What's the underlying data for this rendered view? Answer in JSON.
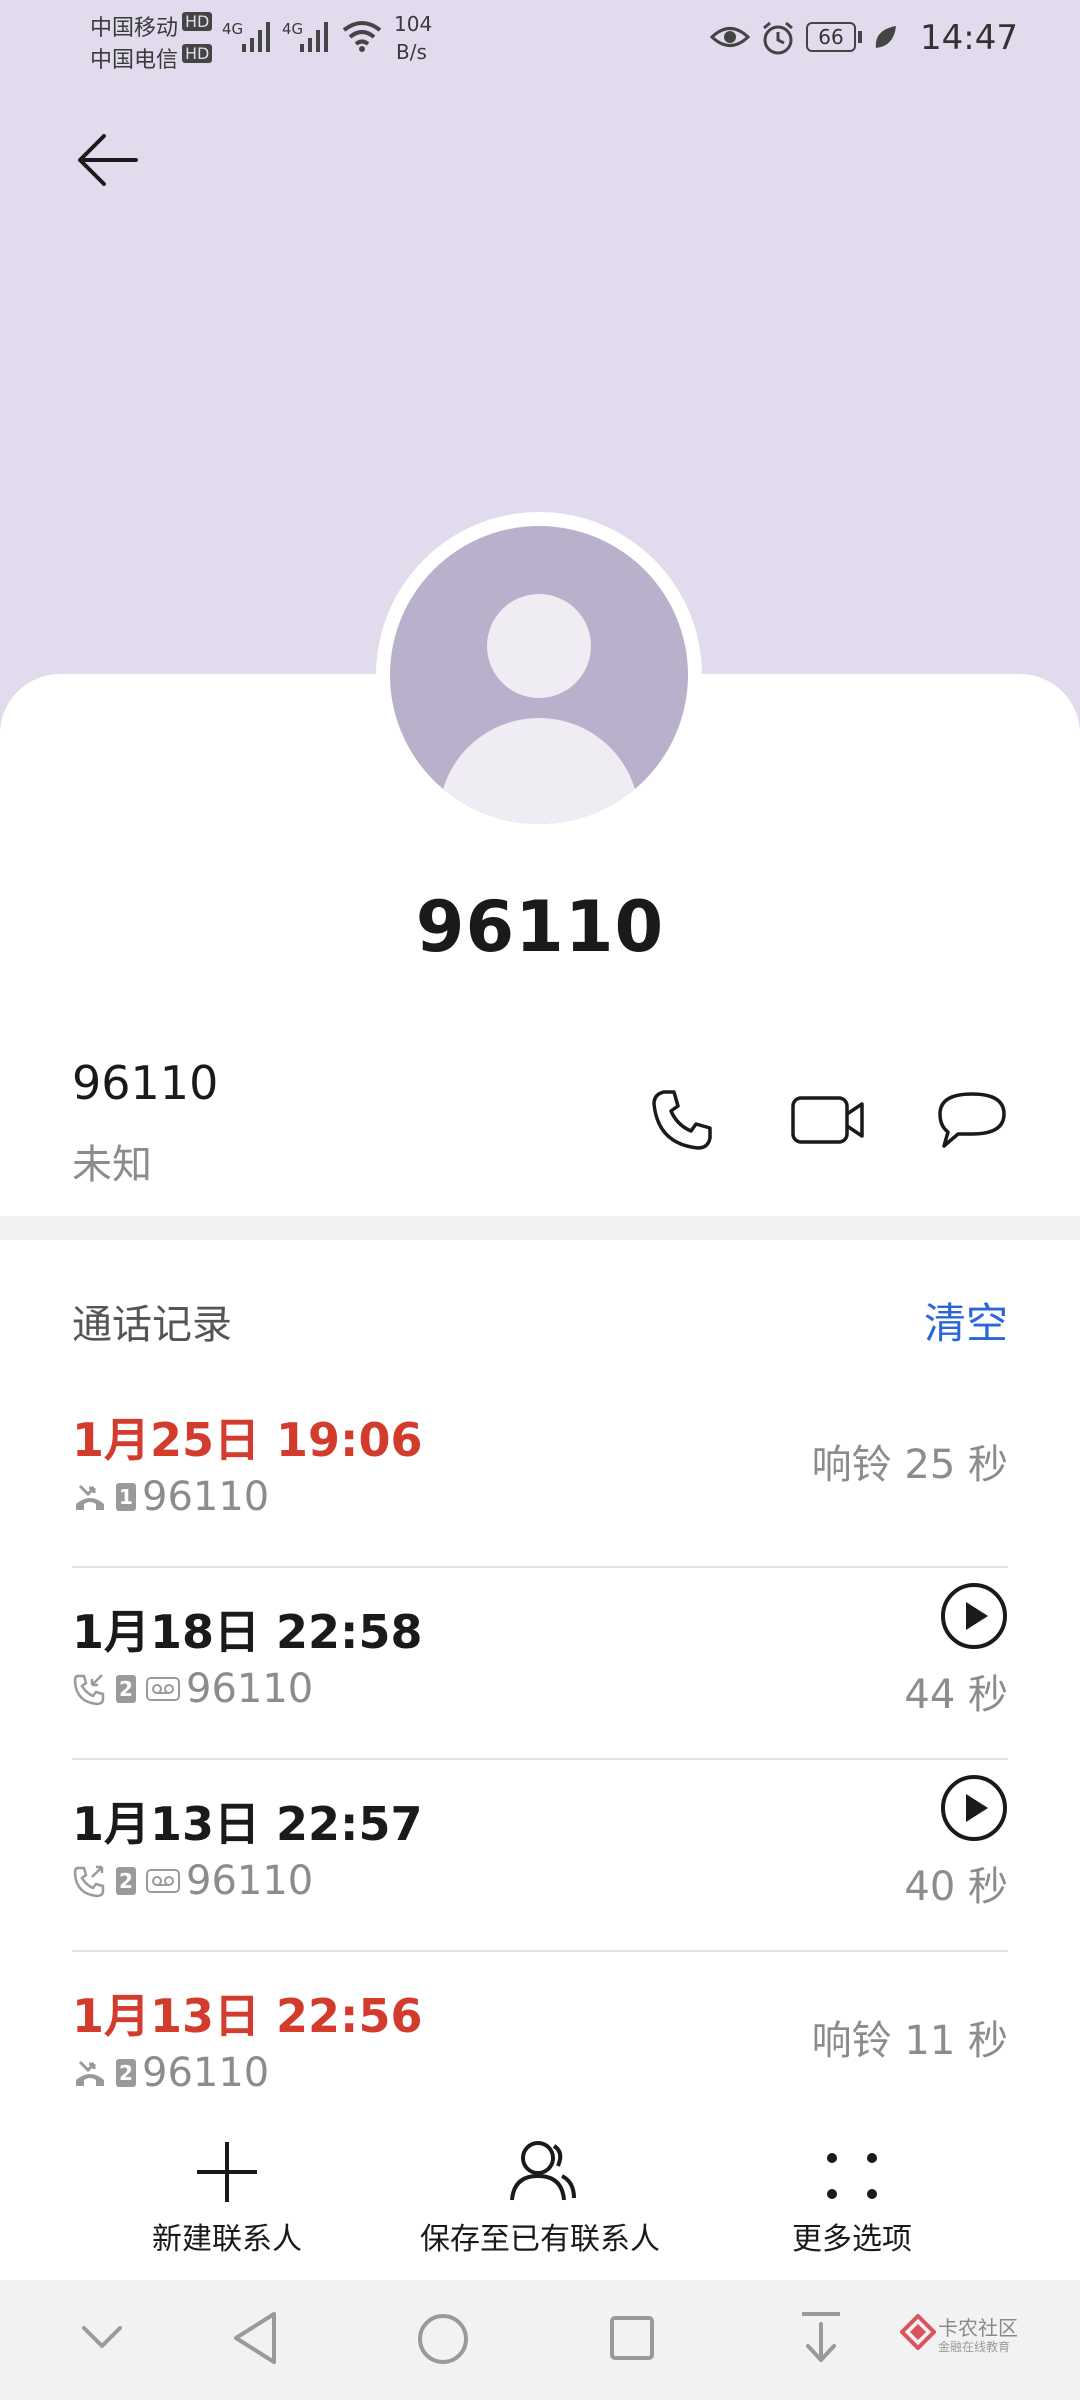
{
  "status_bar": {
    "carrier1": "中国移动",
    "carrier2": "中国电信",
    "hd": "HD",
    "net": "4G",
    "speed_value": "104",
    "speed_unit": "B/s",
    "battery": "66",
    "time": "14:47"
  },
  "contact": {
    "title": "96110",
    "number": "96110",
    "location": "未知"
  },
  "call_log": {
    "title": "通话记录",
    "clear_label": "清空",
    "entries": [
      {
        "date": "1月25日 19:06",
        "sim": "1",
        "number": "96110",
        "duration": "响铃 25 秒",
        "missed": true
      },
      {
        "date": "1月18日 22:58",
        "sim": "2",
        "number": "96110",
        "duration": "44 秒",
        "missed": false
      },
      {
        "date": "1月13日 22:57",
        "sim": "2",
        "number": "96110",
        "duration": "40 秒",
        "missed": false
      },
      {
        "date": "1月13日 22:56",
        "sim": "2",
        "number": "96110",
        "duration": "响铃 11 秒",
        "missed": true
      }
    ]
  },
  "bottom_actions": {
    "new_contact": "新建联系人",
    "save_existing": "保存至已有联系人",
    "more": "更多选项"
  },
  "watermark": {
    "brand": "卡农社区",
    "tagline": "金融在线教育"
  },
  "colors": {
    "header_bg": "#e1dbed",
    "avatar_bg": "#b9b0cb",
    "missed": "#d33b2c",
    "accent": "#2a66d6"
  },
  "icons": [
    "back-arrow-icon",
    "eye-icon",
    "alarm-icon",
    "battery-icon",
    "leaf-icon",
    "phone-icon",
    "video-call-icon",
    "message-icon",
    "missed-call-icon",
    "outgoing-call-icon",
    "voicemail-icon",
    "play-icon",
    "plus-icon",
    "contact-icon",
    "more-dots-icon",
    "nav-collapse-icon",
    "nav-back-icon",
    "nav-home-icon",
    "nav-recents-icon",
    "nav-download-icon"
  ]
}
